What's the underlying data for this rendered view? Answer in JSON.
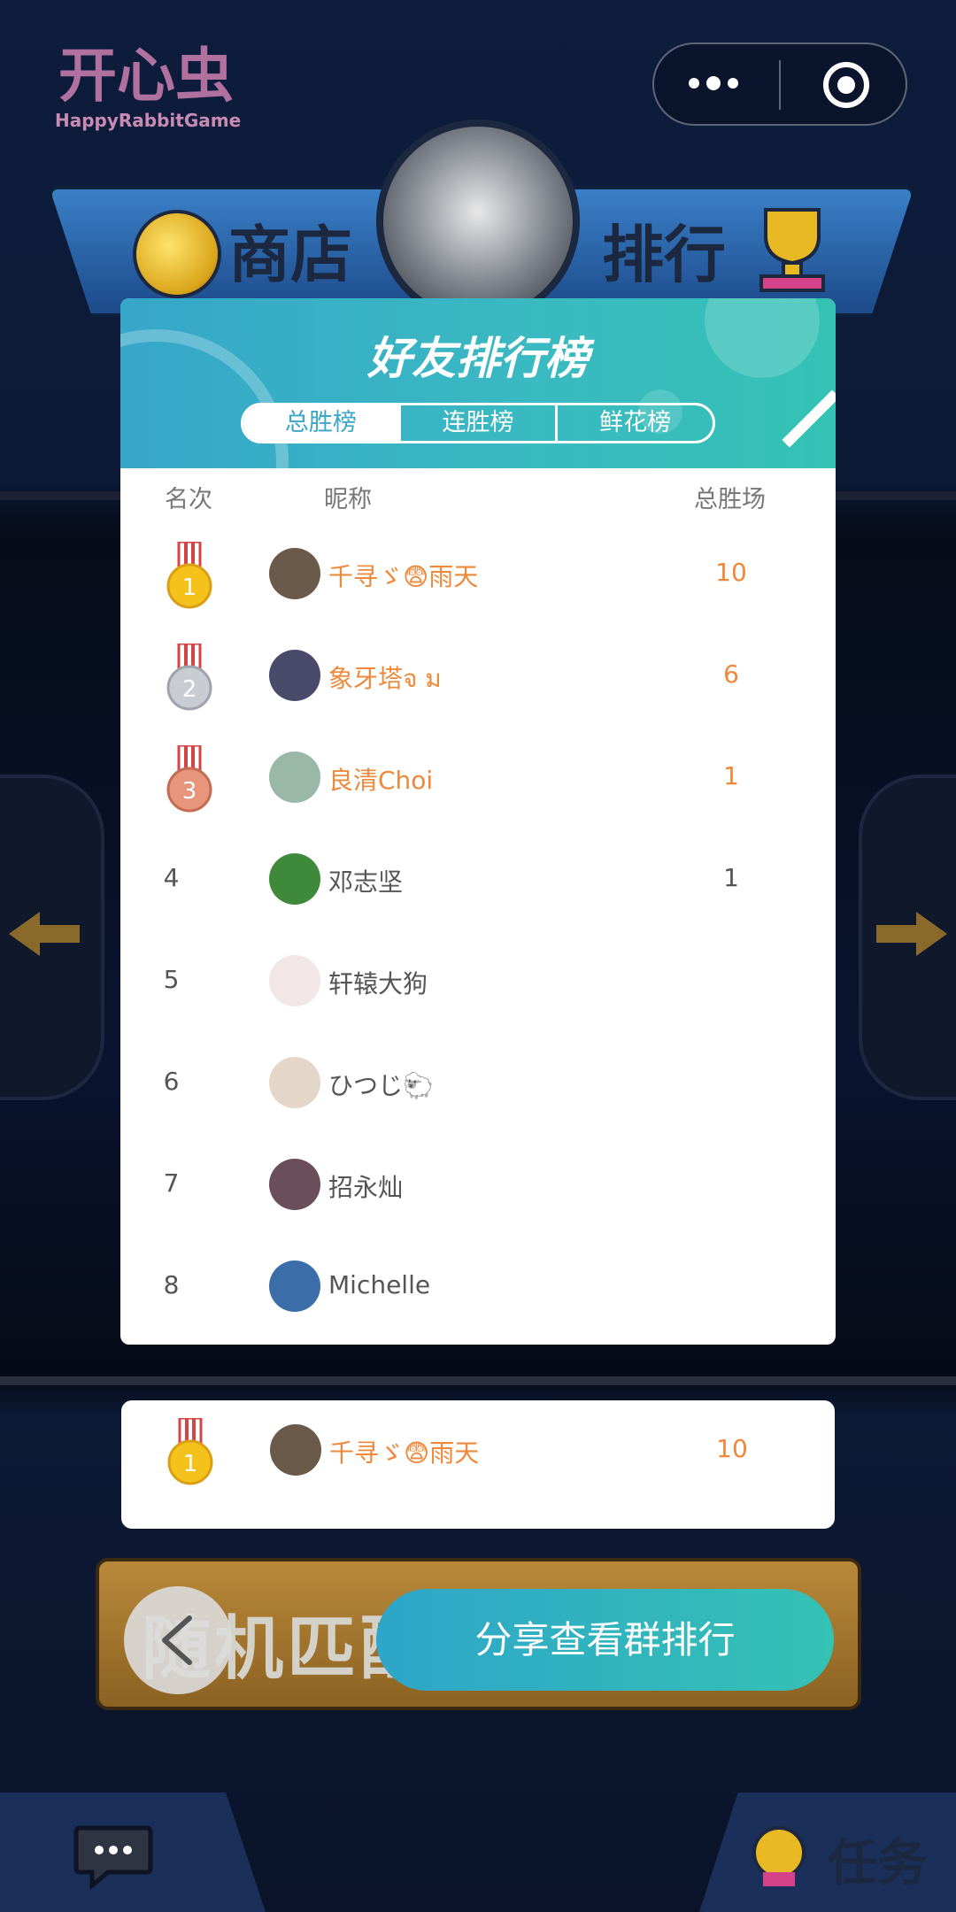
{
  "background": {
    "logo": {
      "text": "HappyRabbitGame"
    },
    "top_nav": {
      "shop_label": "商店",
      "rank_label": "排行"
    },
    "match_button": {
      "label": "随机匹配"
    },
    "bottom_nav": {
      "mission_label": "任务"
    }
  },
  "miniapp_capsule": {
    "menu_icon": "more-dots-icon",
    "close_icon": "target-circle-icon"
  },
  "leaderboard": {
    "title": "好友排行榜",
    "tabs": [
      {
        "label": "总胜榜",
        "selected": true
      },
      {
        "label": "连胜榜",
        "selected": false
      },
      {
        "label": "鲜花榜",
        "selected": false
      }
    ],
    "columns": {
      "rank": "名次",
      "nickname": "昵称",
      "wins": "总胜场"
    },
    "rows": [
      {
        "rank": "1",
        "medal": "gold-medal-icon",
        "nickname": "千寻ゞ😨雨天",
        "wins": "10",
        "avatar_color": "#6b5a4a"
      },
      {
        "rank": "2",
        "medal": "silver-medal-icon",
        "nickname": "象牙塔จ ม",
        "wins": "6",
        "avatar_color": "#4a4b6a"
      },
      {
        "rank": "3",
        "medal": "bronze-medal-icon",
        "nickname": "良清Choi",
        "wins": "1",
        "avatar_color": "#9ab8a8"
      },
      {
        "rank": "4",
        "medal": "",
        "nickname": "邓志坚",
        "wins": "1",
        "avatar_color": "#3f8a3a"
      },
      {
        "rank": "5",
        "medal": "",
        "nickname": "轩辕大狗",
        "wins": "",
        "avatar_color": "#f2e6e6"
      },
      {
        "rank": "6",
        "medal": "",
        "nickname": "ひつじ🐑",
        "wins": "",
        "avatar_color": "#e4d6c8"
      },
      {
        "rank": "7",
        "medal": "",
        "nickname": "招永灿",
        "wins": "",
        "avatar_color": "#6a4e5a"
      },
      {
        "rank": "8",
        "medal": "",
        "nickname": "Michelle",
        "wins": "",
        "avatar_color": "#3b6ea8"
      }
    ]
  },
  "my_rank": {
    "rank": "1",
    "medal": "gold-medal-icon",
    "nickname": "千寻ゞ😨雨天",
    "wins": "10",
    "avatar_color": "#6b5a4a"
  },
  "actions": {
    "back_icon": "chevron-left-icon",
    "share_label": "分享查看群排行"
  },
  "colors": {
    "accent_start": "#2ea5c9",
    "accent_end": "#34c2b4",
    "highlight_text": "#f0883a"
  }
}
